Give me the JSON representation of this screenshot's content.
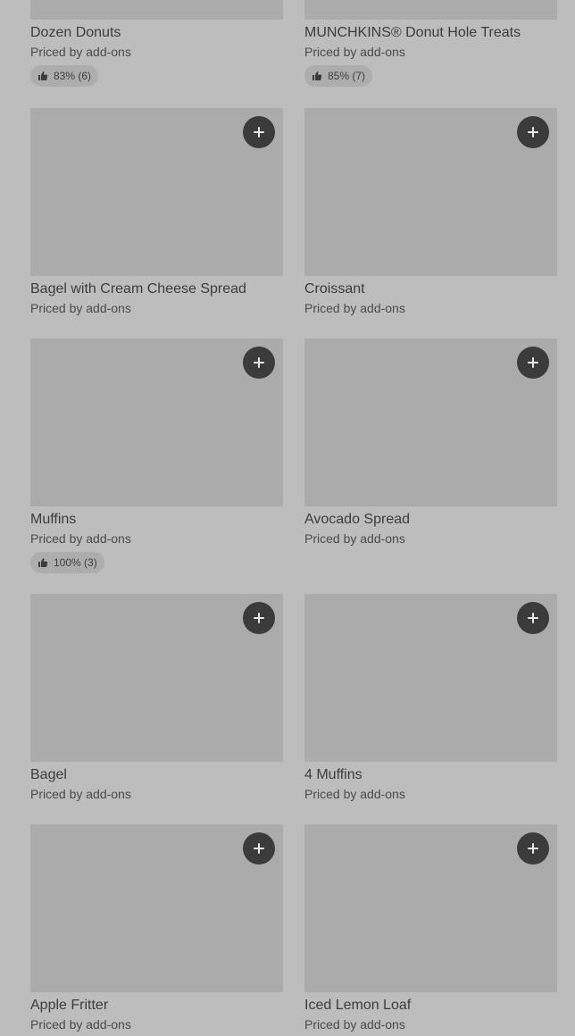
{
  "colors": {
    "page_background": "#bdbdbd",
    "thumbnail": "#ababab",
    "add_button": "#3b3b3b",
    "rating_pill": "#adadad",
    "text_primary": "#3c3c3c"
  },
  "icons": {
    "add": "plus-icon",
    "rating": "thumbs-up-icon"
  },
  "items": [
    {
      "name": "Dozen Donuts",
      "price": "Priced by add-ons",
      "rating": "83% (6)"
    },
    {
      "name": "MUNCHKINS® Donut Hole Treats",
      "price": "Priced by add-ons",
      "rating": "85% (7)"
    },
    {
      "name": "Bagel with Cream Cheese Spread",
      "price": "Priced by add-ons"
    },
    {
      "name": "Croissant",
      "price": "Priced by add-ons"
    },
    {
      "name": "Muffins",
      "price": "Priced by add-ons",
      "rating": "100% (3)"
    },
    {
      "name": "Avocado Spread",
      "price": "Priced by add-ons"
    },
    {
      "name": "Bagel",
      "price": "Priced by add-ons"
    },
    {
      "name": "4 Muffins",
      "price": "Priced by add-ons"
    },
    {
      "name": "Apple Fritter",
      "price": "Priced by add-ons"
    },
    {
      "name": "Iced Lemon Loaf",
      "price": "Priced by add-ons"
    }
  ]
}
